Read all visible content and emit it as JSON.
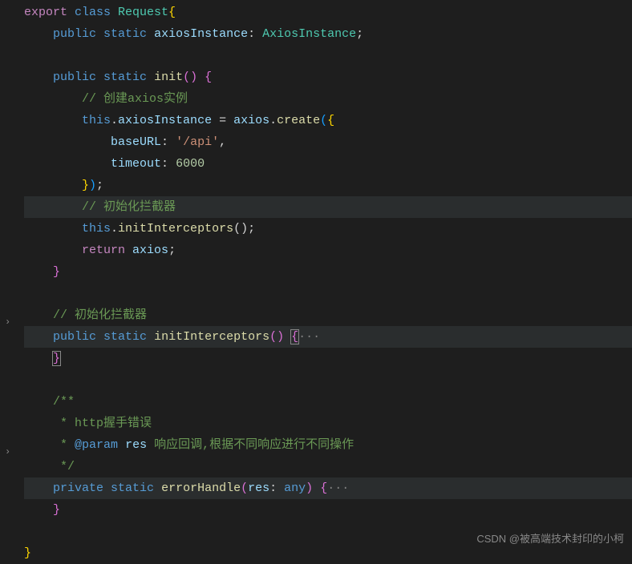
{
  "code": {
    "line1_class_open": "{",
    "line2_public": "public",
    "line2_static": "static",
    "line2_prop": "axiosInstance",
    "line2_colon": ":",
    "line2_type": "AxiosInstance",
    "line2_semi": ";",
    "line4_public": "public",
    "line4_static": "static",
    "line4_fn": "init",
    "line4_parens": "()",
    "line4_brace": "{",
    "line5_comment": "// 创建axios实例",
    "line6_this": "this",
    "line6_dot": ".",
    "line6_prop": "axiosInstance",
    "line6_eq": " = ",
    "line6_axios": "axios",
    "line6_create": "create",
    "line6_open": "(",
    "line6_brace": "{",
    "line7_key": "baseURL",
    "line7_colon": ": ",
    "line7_val": "'/api'",
    "line7_comma": ",",
    "line8_key": "timeout",
    "line8_colon": ": ",
    "line8_val": "6000",
    "line9_close_brace": "}",
    "line9_close_paren": ")",
    "line9_semi": ";",
    "line10_comment": "// 初始化拦截器",
    "line11_this": "this",
    "line11_dot": ".",
    "line11_fn": "initInterceptors",
    "line11_call": "();",
    "line12_return": "return",
    "line12_axios": "axios",
    "line12_semi": ";",
    "line13_brace": "}",
    "line15_comment": "// 初始化拦截器",
    "line16_public": "public",
    "line16_static": "static",
    "line16_fn": "initInterceptors",
    "line16_parens": "()",
    "line16_brace_open": "{",
    "line16_dots": "···",
    "line17_brace": "}",
    "line19_doc1": "/**",
    "line20_doc2": " * http握手错误",
    "line21_doc3a": " * ",
    "line21_tag": "@param",
    "line21_param": "res",
    "line21_desc": " 响应回调,根据不同响应进行不同操作",
    "line22_doc4": " */",
    "line23_private": "private",
    "line23_static": "static",
    "line23_fn": "errorHandle",
    "line23_open": "(",
    "line23_param": "res",
    "line23_colon": ": ",
    "line23_type": "any",
    "line23_close": ")",
    "line23_brace": "{",
    "line23_dots": "···",
    "line24_brace": "}",
    "line26_brace": "}"
  },
  "watermark": "CSDN @被高端技术封印的小柯",
  "fold_chevron": "›"
}
